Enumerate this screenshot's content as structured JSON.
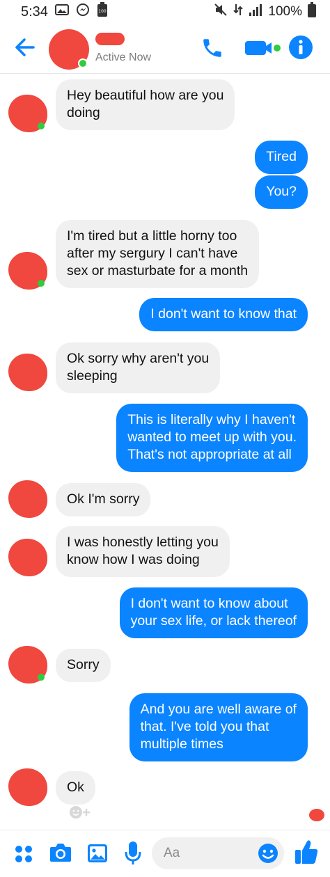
{
  "status_bar": {
    "time": "5:34",
    "battery_label": "100",
    "battery": "100%",
    "icons": [
      "gallery-icon",
      "messenger-icon",
      "battery-saver-icon",
      "mute-icon",
      "data-icon",
      "signal-icon",
      "battery-icon"
    ]
  },
  "header": {
    "status": "Active Now",
    "icons": [
      "back-arrow-icon",
      "phone-icon",
      "video-icon",
      "info-icon"
    ]
  },
  "messages": [
    {
      "from": "them",
      "text": "Hey beautiful how are you\ndoing"
    },
    {
      "from": "me",
      "text": "Tired"
    },
    {
      "from": "me",
      "text": "You?"
    },
    {
      "from": "them",
      "text": "I'm tired but a little horny too\nafter my sergury I can't have\nsex or masturbate for a month"
    },
    {
      "from": "me",
      "text": "I don't want to know that"
    },
    {
      "from": "them",
      "text": "Ok sorry why aren't you\nsleeping"
    },
    {
      "from": "me",
      "text": "This is literally why I haven't\nwanted to meet up with you.\nThat's not appropriate at all"
    },
    {
      "from": "them",
      "text": "Ok I'm sorry"
    },
    {
      "from": "them",
      "text": "I was honestly letting you\nknow how I was doing"
    },
    {
      "from": "me",
      "text": "I don't want to know about\nyour sex life, or lack thereof"
    },
    {
      "from": "them",
      "text": "Sorry"
    },
    {
      "from": "me",
      "text": "And you are well aware of\nthat. I've told you that\nmultiple times"
    },
    {
      "from": "them",
      "text": "Ok"
    }
  ],
  "composer": {
    "placeholder": "Aa",
    "icons": [
      "menu-dots-icon",
      "camera-icon",
      "gallery-icon",
      "microphone-icon",
      "emoji-icon",
      "thumbs-up-icon"
    ]
  },
  "colors": {
    "accent": "#0b84ff",
    "incoming_bubble": "#f1f0f0",
    "redaction": "#f0473e",
    "online": "#2fcc40"
  }
}
